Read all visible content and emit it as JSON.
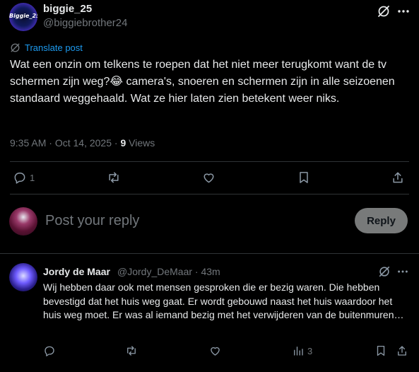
{
  "main_post": {
    "avatar_text": "Biggie_25",
    "display_name": "biggie_25",
    "handle": "@biggiebrother24",
    "translate_label": "Translate post",
    "text": "Wat een onzin om telkens te roepen dat het niet meer terugkomt want de tv schermen zijn weg?😂 camera's, snoeren en schermen zijn in alle seizoenen standaard weggehaald. Wat ze hier laten zien betekent weer niks.",
    "time": "9:35 AM",
    "separator": " · ",
    "date": "Oct 14, 2025",
    "views_count": "9",
    "views_label": "Views",
    "actions": {
      "reply_count": "1"
    }
  },
  "composer": {
    "placeholder": "Post your reply",
    "reply_button_label": "Reply"
  },
  "reply": {
    "display_name": "Jordy de Maar",
    "handle": "@Jordy_DeMaar",
    "time": "· 43m",
    "text": "Wij hebben daar ook met mensen gesproken die er bezig waren. Die hebben bevestigd dat het huis weg gaat. Er wordt gebouwd naast het huis waardoor het huis weg moet. Er was al iemand bezig met het verwijderen van de buitenmuren…",
    "views_count": "3"
  },
  "colors": {
    "background": "#000000",
    "text": "#e7e9ea",
    "muted": "#71767b",
    "link": "#1d9bf0",
    "divider": "#2f3336",
    "reply_button": "#787a7a"
  },
  "icons": [
    "grok-icon",
    "more-icon",
    "translate-icon",
    "reply-icon",
    "repost-icon",
    "like-icon",
    "bookmark-icon",
    "share-icon",
    "views-icon"
  ]
}
